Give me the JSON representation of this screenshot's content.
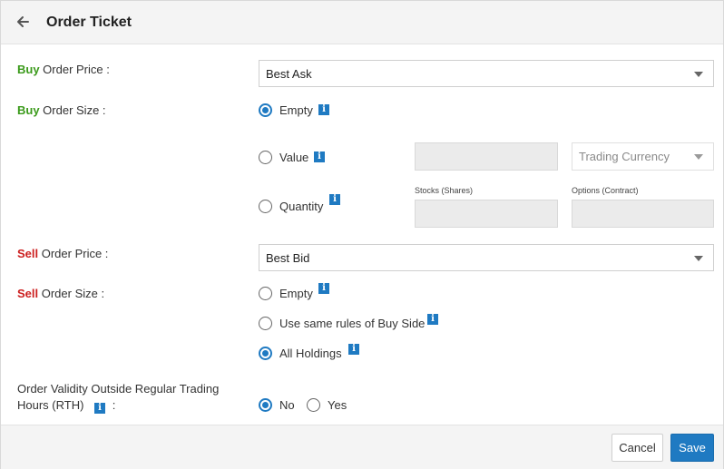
{
  "header": {
    "title": "Order Ticket",
    "back_icon": "arrow-left-icon"
  },
  "buy": {
    "side_label": "Buy",
    "price_label": " Order Price :",
    "price_value": "Best Ask",
    "size_label": " Order Size :",
    "size_options": {
      "empty": "Empty",
      "value": "Value",
      "quantity": "Quantity"
    },
    "selected_size": "empty",
    "currency_placeholder": "Trading Currency",
    "stocks_label": "Stocks (Shares)",
    "options_label": "Options (Contract)"
  },
  "sell": {
    "side_label": "Sell",
    "price_label": " Order Price :",
    "price_value": "Best Bid",
    "size_label": " Order Size :",
    "size_options": {
      "empty": "Empty",
      "same_rules": "Use same rules of Buy Side",
      "all_holdings": "All Holdings"
    },
    "selected_size": "all_holdings"
  },
  "validity": {
    "label_line1": "Order Validity Outside Regular Trading",
    "label_line2": "Hours (RTH)",
    "label_colon": ":",
    "no": "No",
    "yes": "Yes",
    "selected": "no"
  },
  "info_glyph": "i",
  "footer": {
    "cancel_label": "Cancel",
    "save_label": "Save"
  },
  "colors": {
    "accent": "#1f7ac2",
    "buy": "#3a9a1a",
    "sell": "#cc1f1f"
  }
}
